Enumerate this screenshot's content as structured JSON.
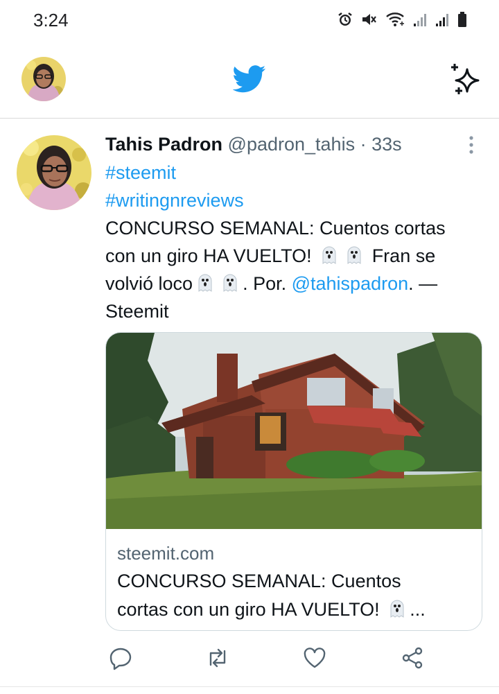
{
  "status_bar": {
    "time": "3:24",
    "icons": [
      "alarm-icon",
      "mute-icon",
      "wifi-icon",
      "signal-icon",
      "signal-icon",
      "battery-icon"
    ]
  },
  "header": {
    "logo_icon": "twitter-bird-icon",
    "sparkle_icon": "sparkle-icon",
    "accent_color": "#1d9bf0"
  },
  "tweet": {
    "display_name": "Tahis Padron",
    "handle": "@padron_tahis",
    "separator": " · ",
    "time_ago": "33s",
    "hashtag1": "#steemit",
    "hashtag2": "#writingnreviews",
    "text_line1": "CONCURSO SEMANAL: Cuentos cortas",
    "text_line2a": "con un giro HA VUELTO!",
    "text_line2b": "Fran se",
    "text_line3a": "volvió loco",
    "text_line3b": ". Por.",
    "mention": "@tahispadron",
    "text_line3c": ". —",
    "text_line4": "Steemit",
    "card": {
      "domain": "steemit.com",
      "title_line1": "CONCURSO SEMANAL: Cuentos",
      "title_line2": "cortas con un giro HA VUELTO!",
      "title_ellipsis": "..."
    },
    "actions": [
      "reply-icon",
      "retweet-icon",
      "like-icon",
      "share-icon"
    ]
  }
}
